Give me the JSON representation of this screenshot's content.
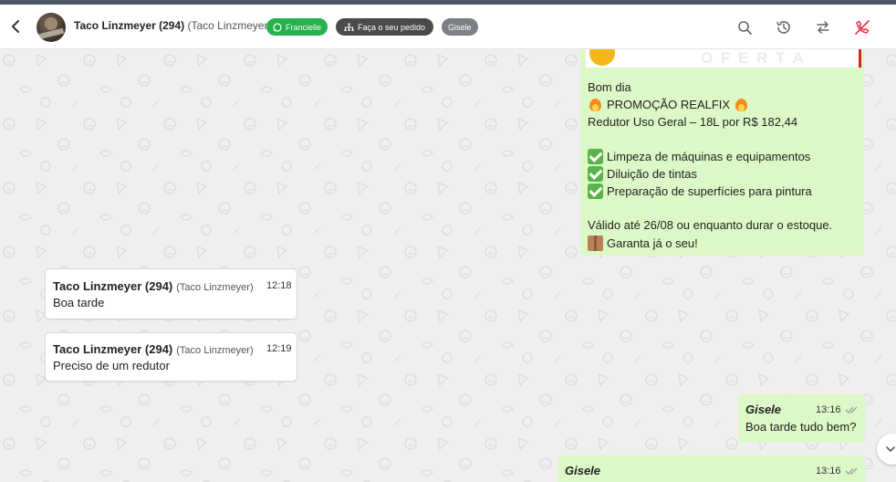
{
  "contact": {
    "name": "Taco Linzmeyer (294)",
    "sub": "(Taco Linzmeyer)"
  },
  "chips": {
    "agent": "Francielle",
    "order": "Faça o seu pedido",
    "user": "Gisele"
  },
  "banner": {
    "partial_text": "O F E R T A"
  },
  "promo": {
    "greeting": "Bom dia",
    "headline": "PROMOÇÃO REALFIX",
    "product": "Redutor Uso Geral – 18L por R$ 182,44",
    "features": [
      "Limpeza de máquinas e equipamentos",
      "Diluição de tintas",
      "Preparação de superfícies para pintura"
    ],
    "validity": "Válido até 26/08 ou enquanto durar o estoque.",
    "cta": "Garanta já o seu!"
  },
  "messages": {
    "in1": {
      "name": "Taco Linzmeyer (294)",
      "sub": "(Taco Linzmeyer)",
      "time": "12:18",
      "text": "Boa tarde"
    },
    "in2": {
      "name": "Taco Linzmeyer (294)",
      "sub": "(Taco Linzmeyer)",
      "time": "12:19",
      "text": "Preciso de um redutor"
    },
    "out1": {
      "name": "Gisele",
      "time": "13:16",
      "text": "Boa tarde tudo bem?"
    },
    "out2": {
      "name": "Gisele",
      "time": "13:16"
    }
  },
  "icons": {
    "header": [
      "back-arrow-icon",
      "search-icon",
      "history-icon",
      "transfer-icon",
      "end-chat-icon"
    ],
    "chip_agent": "whatsapp-icon",
    "chip_order": "sitemap-icon"
  },
  "colors": {
    "header_bar": "#4b5563",
    "outgoing_bubble": "#dcf8c6",
    "incoming_bubble": "#ffffff",
    "chip_green": "#25b14b",
    "end_chat_red": "#e0334b"
  }
}
